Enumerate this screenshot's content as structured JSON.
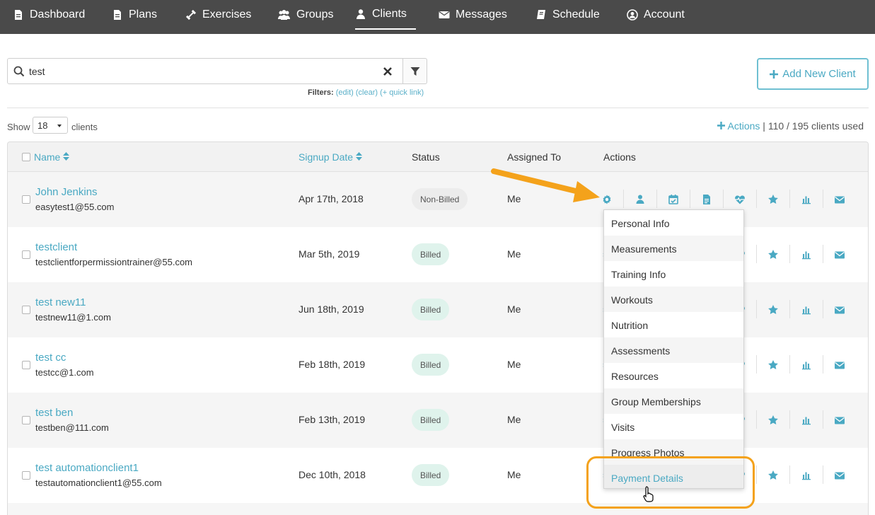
{
  "nav": {
    "items": [
      {
        "label": "Dashboard",
        "icon": "file-icon"
      },
      {
        "label": "Plans",
        "icon": "file-icon"
      },
      {
        "label": "Exercises",
        "icon": "dumbbell-icon"
      },
      {
        "label": "Groups",
        "icon": "users-icon"
      },
      {
        "label": "Clients",
        "icon": "user-icon",
        "active": true
      },
      {
        "label": "Messages",
        "icon": "envelope-icon"
      },
      {
        "label": "Schedule",
        "icon": "book-icon"
      },
      {
        "label": "Account",
        "icon": "user-circle-icon"
      }
    ]
  },
  "search": {
    "value": "test",
    "filters_label": "Filters:",
    "filters_edit": "(edit)",
    "filters_clear": "(clear)",
    "filters_quick": "(+ quick link)"
  },
  "add_client_label": "Add New Client",
  "show": {
    "label": "Show",
    "value": "18",
    "suffix": "clients"
  },
  "actions_top": {
    "label": "Actions",
    "usage": "| 110 / 195 clients used"
  },
  "table": {
    "headers": {
      "name": "Name",
      "signup": "Signup Date",
      "status": "Status",
      "assigned": "Assigned To",
      "actions": "Actions"
    },
    "rows": [
      {
        "name": "John Jenkins",
        "email": "easytest1@55.com",
        "date": "Apr 17th, 2018",
        "status": "Non-Billed",
        "assigned": "Me"
      },
      {
        "name": "testclient",
        "email": "testclientforpermissiontrainer@55.com",
        "date": "Mar 5th, 2019",
        "status": "Billed",
        "assigned": "Me"
      },
      {
        "name": "test new11",
        "email": "testnew11@1.com",
        "date": "Jun 18th, 2019",
        "status": "Billed",
        "assigned": "Me"
      },
      {
        "name": "test cc",
        "email": "testcc@1.com",
        "date": "Feb 18th, 2019",
        "status": "Billed",
        "assigned": "Me"
      },
      {
        "name": "test ben",
        "email": "testben@111.com",
        "date": "Feb 13th, 2019",
        "status": "Billed",
        "assigned": "Me"
      },
      {
        "name": "test automationclient1",
        "email": "testautomationclient1@55.com",
        "date": "Dec 10th, 2018",
        "status": "Billed",
        "assigned": "Me"
      }
    ],
    "action_icons": [
      "gear-icon",
      "user-icon",
      "calendar-check-icon",
      "document-icon",
      "heartbeat-icon",
      "star-icon",
      "bar-chart-icon",
      "envelope-icon"
    ]
  },
  "dropdown": {
    "items": [
      "Personal Info",
      "Measurements",
      "Training Info",
      "Workouts",
      "Nutrition",
      "Assessments",
      "Resources",
      "Group Memberships",
      "Visits",
      "Progress Photos",
      "Payment Details"
    ],
    "highlighted": "Payment Details"
  },
  "colors": {
    "nav_bg": "#4a4a4a",
    "accent": "#4aa9c3",
    "billed_bg": "#dff3ec",
    "annotation": "#f4a21b"
  }
}
